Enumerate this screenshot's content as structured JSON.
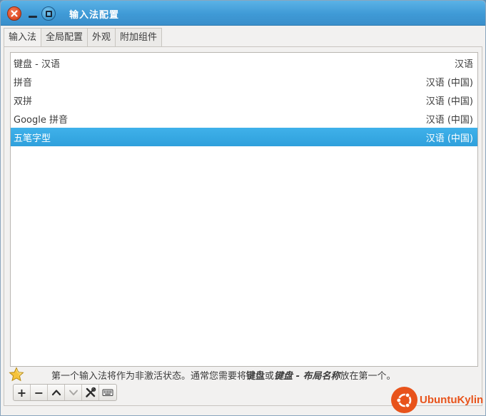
{
  "window": {
    "title": "输入法配置"
  },
  "tabs": [
    {
      "label": "输入法",
      "active": true
    },
    {
      "label": "全局配置",
      "active": false
    },
    {
      "label": "外观",
      "active": false
    },
    {
      "label": "附加组件",
      "active": false
    }
  ],
  "input_methods": [
    {
      "name": "键盘 - 汉语",
      "language": "汉语",
      "selected": false
    },
    {
      "name": "拼音",
      "language": "汉语 (中国)",
      "selected": false
    },
    {
      "name": "双拼",
      "language": "汉语 (中国)",
      "selected": false
    },
    {
      "name": "Google 拼音",
      "language": "汉语 (中国)",
      "selected": false
    },
    {
      "name": "五笔字型",
      "language": "汉语 (中国)",
      "selected": true
    }
  ],
  "hint": {
    "part1": "第一个输入法将作为非激活状态。通常您需要将",
    "bold1": "键盘",
    "part2": "或",
    "bold_italic": "键盘 - 布局名称",
    "part3": "放在第一个。"
  },
  "toolbar": {
    "add": "+",
    "remove": "−"
  },
  "watermark": {
    "text": "UbuntuKylin"
  },
  "colors": {
    "titlebar": "#3f9ad6",
    "selection": "#2fa0dc",
    "brand": "#e8531b"
  }
}
